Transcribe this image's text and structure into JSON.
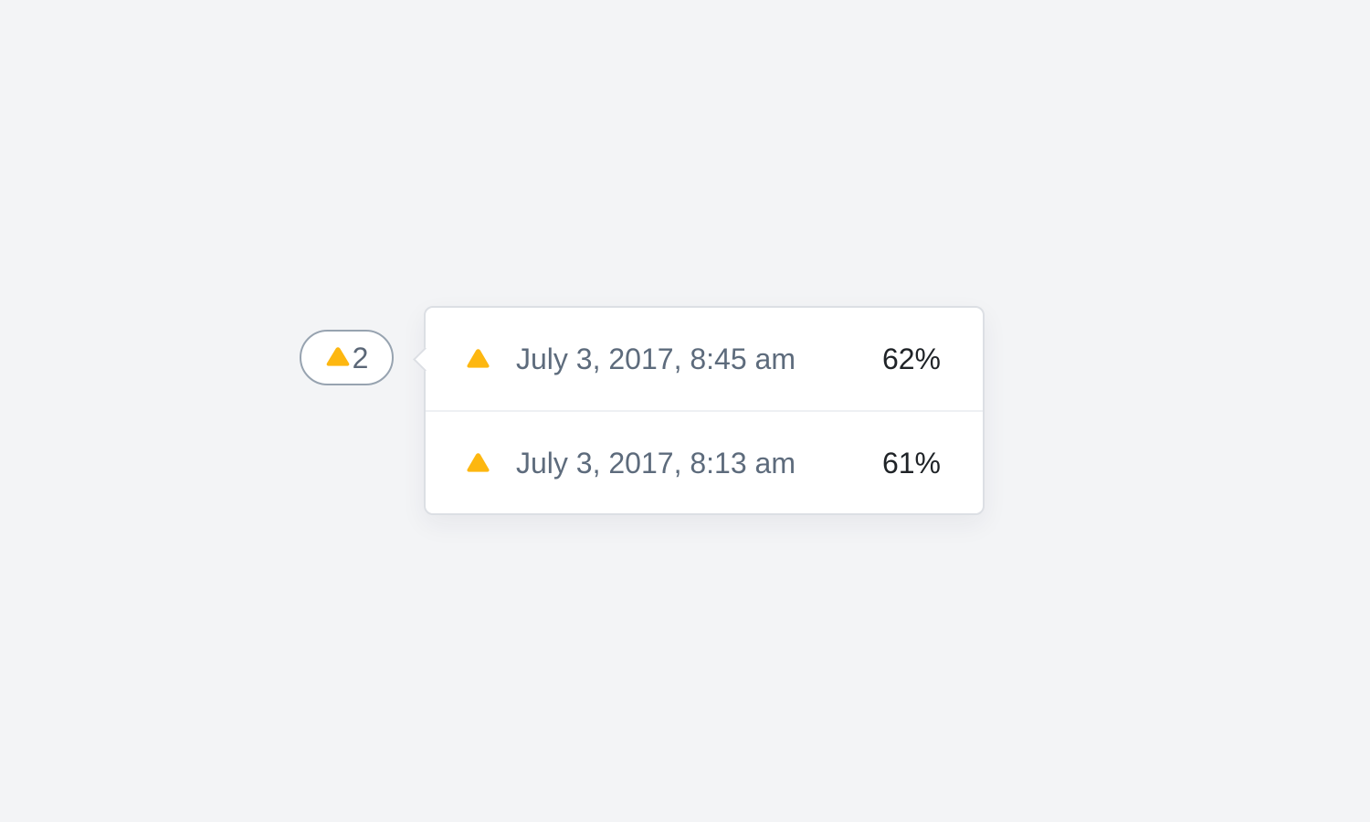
{
  "colors": {
    "background": "#f3f4f6",
    "warning": "#fdb710",
    "badge_border": "#97a3b0",
    "date_text": "#5d6b7c",
    "value_text": "#1f2327"
  },
  "badge": {
    "icon": "warning-triangle-icon",
    "count": "2"
  },
  "popover": {
    "items": [
      {
        "icon": "warning-triangle-icon",
        "date": "July 3, 2017, 8:45 am",
        "value": "62%"
      },
      {
        "icon": "warning-triangle-icon",
        "date": "July 3, 2017, 8:13 am",
        "value": "61%"
      }
    ]
  }
}
